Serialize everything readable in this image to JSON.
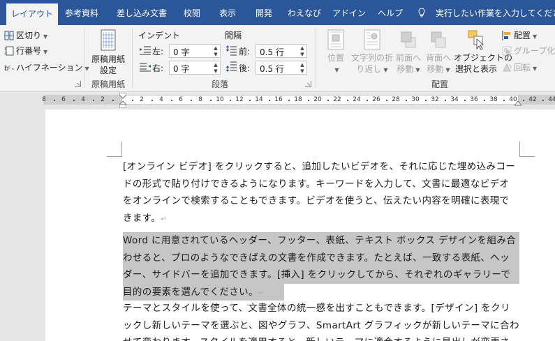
{
  "tabs": [
    "レイアウト",
    "参考資料",
    "差し込み文書",
    "校閲",
    "表示",
    "開発",
    "わえなび",
    "アドイン",
    "ヘルプ"
  ],
  "active_tab": "レイアウト",
  "tell_me": "実行したい作業を入力してください",
  "page_setup": {
    "breaks": "区切り",
    "line_numbers": "行番号",
    "hyphenation": "ハイフネーション"
  },
  "genko": {
    "button_line1": "原稿用紙",
    "button_line2": "設定",
    "group_label": "原稿用紙"
  },
  "paragraph": {
    "indent_heading": "インデント",
    "spacing_heading": "間隔",
    "left_label": "左:",
    "right_label": "右:",
    "before_label": "前:",
    "after_label": "後:",
    "left_value": "0 字",
    "right_value": "0 字",
    "before_value": "0.5 行",
    "after_value": "0.5 行",
    "group_label": "段落"
  },
  "arrange": {
    "position": "位置",
    "wrap_line1": "文字列の折",
    "wrap_line2": "り返し",
    "forward_line1": "前面へ",
    "forward_line2": "移動",
    "backward_line1": "背面へ",
    "backward_line2": "移動",
    "select_line1": "オブジェクトの",
    "select_line2": "選択と表示",
    "align": "配置",
    "group": "グループ化",
    "rotate": "回転",
    "group_label": "配置"
  },
  "ruler_ticks": [
    "8",
    "6",
    "4",
    "2",
    "2",
    "4",
    "6",
    "8",
    "10",
    "12",
    "14",
    "16",
    "18",
    "20",
    "22",
    "24",
    "26",
    "28",
    "30",
    "32",
    "34",
    "36",
    "38",
    "40",
    "42",
    "44"
  ],
  "document": {
    "para1": [
      "[オンライン ビデオ] をクリックすると、追加したいビデオを、それに応じた埋め込みコー",
      "ドの形式で貼り付けできるようになります。キーワードを入力して、文書に最適なビデオ",
      "をオンラインで検索することもできます。ビデオを使うと、伝えたい内容を明確に表現で",
      "きます。"
    ],
    "para2": [
      "Word に用意されているヘッダー、フッター、表紙、テキスト ボックス デザインを組み合",
      "わせると、プロのようなできばえの文書を作成できます。たとえば、一致する表紙、ヘッ",
      "ダー、サイドバーを追加できます。[挿入] をクリックしてから、それぞれのギャラリーで",
      "目的の要素を選んでください。"
    ],
    "para3": [
      "テーマとスタイルを使って、文書全体の統一感を出すこともできます。[デザイン] をクリ",
      "ックし新しいテーマを選ぶと、図やグラフ、SmartArt グラフィックが新しいテーマに合わ",
      "せて変わります。スタイルを適用すると、新しいテーマに適合するように見出しが変更さ"
    ]
  },
  "colors": {
    "tab_bar": "#2b579a",
    "ribbon": "#f3f3f3",
    "highlight": "#c6c6c6"
  }
}
